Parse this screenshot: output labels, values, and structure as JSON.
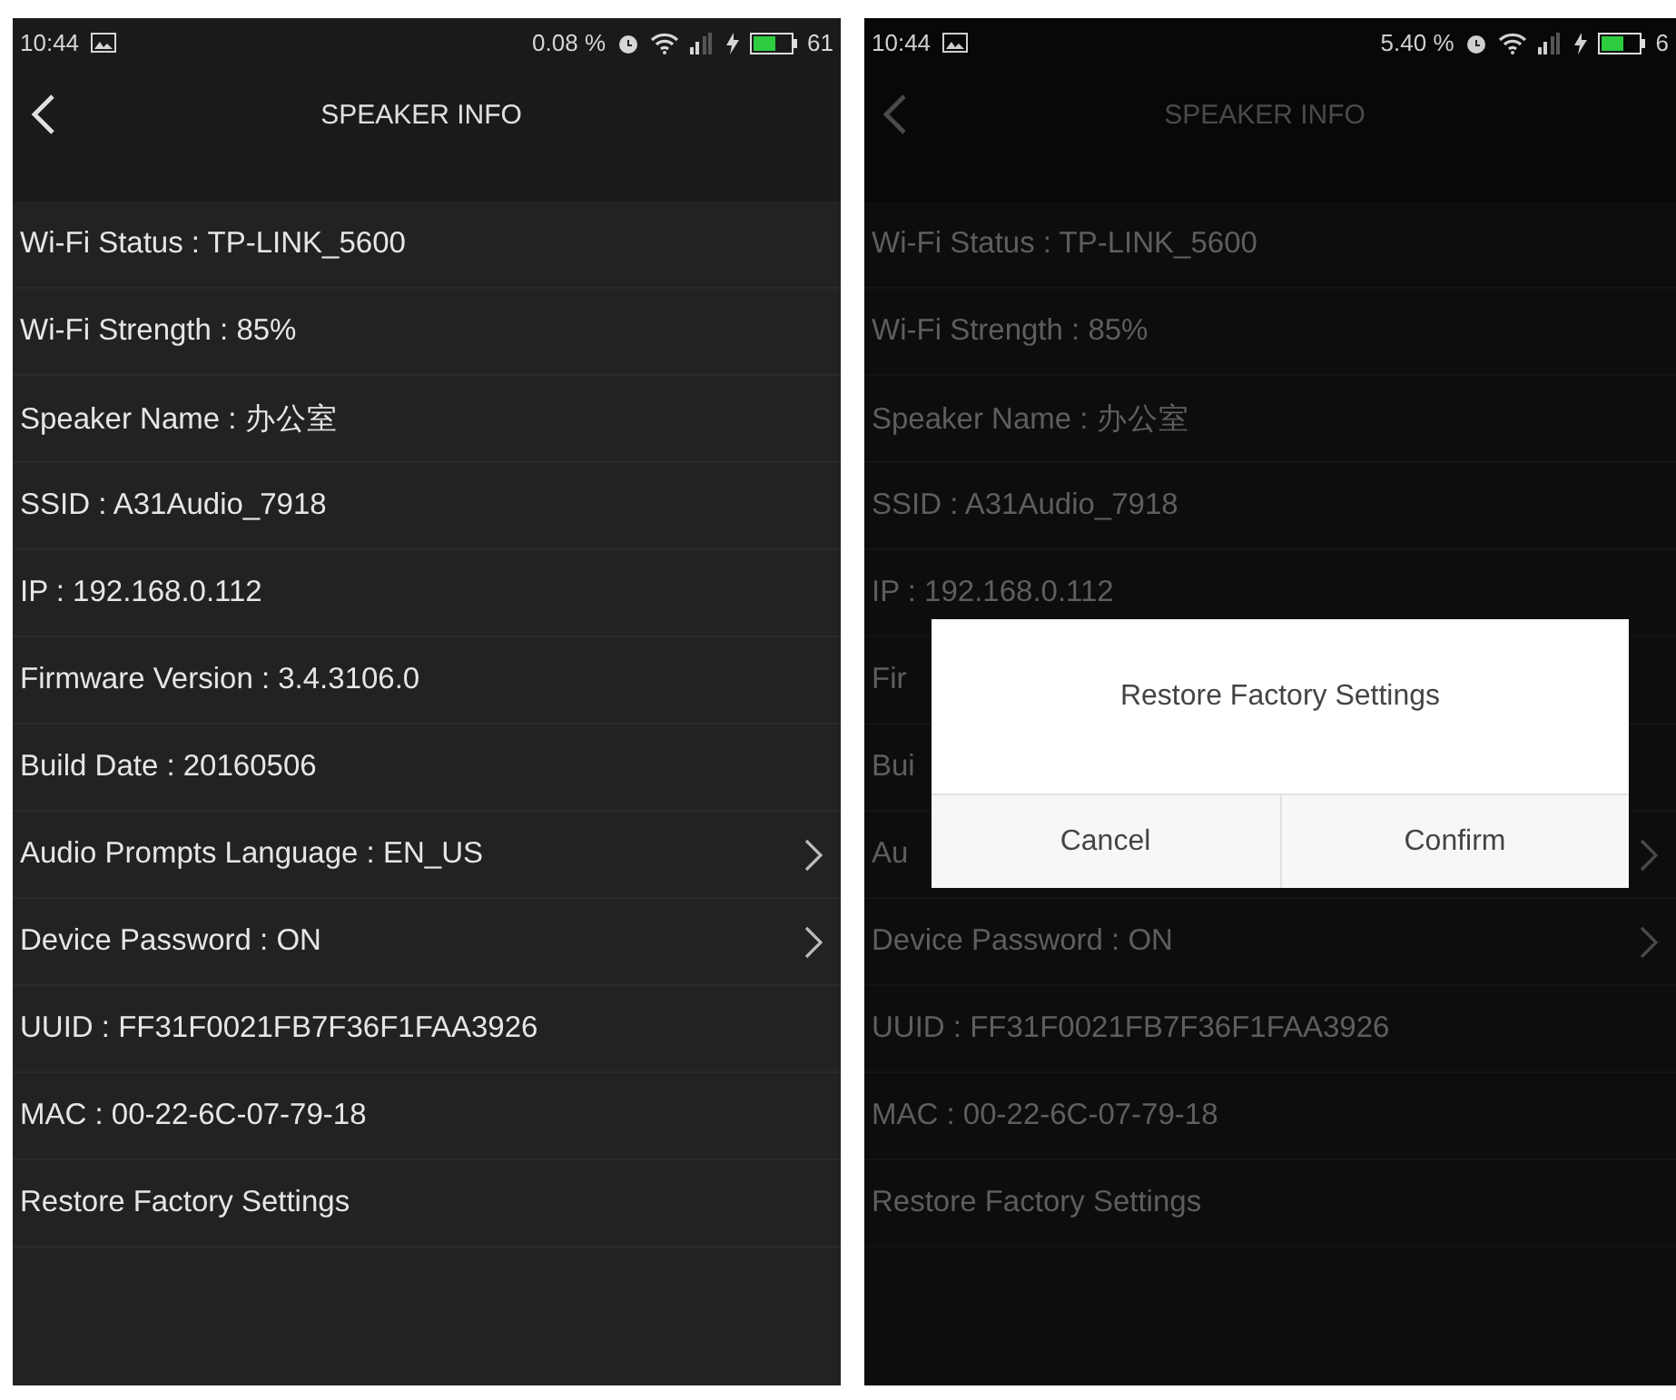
{
  "screens": [
    {
      "dimmed": false,
      "status_bar": {
        "time": "10:44",
        "data_rate": "0.08 %",
        "battery": "61"
      },
      "title": "SPEAKER INFO",
      "rows": [
        {
          "label": "Wi-Fi Status : TP-LINK_5600",
          "chevron": false
        },
        {
          "label": "Wi-Fi Strength : 85%",
          "chevron": false
        },
        {
          "label": "Speaker Name : 办公室",
          "chevron": false
        },
        {
          "label": "SSID : A31Audio_7918",
          "chevron": false
        },
        {
          "label": "IP : 192.168.0.112",
          "chevron": false
        },
        {
          "label": "Firmware Version : 3.4.3106.0",
          "chevron": false
        },
        {
          "label": "Build Date : 20160506",
          "chevron": false
        },
        {
          "label": "Audio Prompts Language : EN_US",
          "chevron": true
        },
        {
          "label": "Device Password : ON",
          "chevron": true
        },
        {
          "label": "UUID : FF31F0021FB7F36F1FAA3926",
          "chevron": false
        },
        {
          "label": "MAC : 00-22-6C-07-79-18",
          "chevron": false
        },
        {
          "label": "Restore Factory Settings",
          "chevron": false
        }
      ]
    },
    {
      "dimmed": true,
      "status_bar": {
        "time": "10:44",
        "data_rate": "5.40 %",
        "battery": "6"
      },
      "title": "SPEAKER INFO",
      "rows": [
        {
          "label": "Wi-Fi Status : TP-LINK_5600",
          "chevron": false
        },
        {
          "label": "Wi-Fi Strength : 85%",
          "chevron": false
        },
        {
          "label": "Speaker Name : 办公室",
          "chevron": false
        },
        {
          "label": "SSID : A31Audio_7918",
          "chevron": false
        },
        {
          "label": "IP : 192.168.0.112",
          "chevron": false
        },
        {
          "label": "Fir",
          "chevron": false
        },
        {
          "label": "Bui",
          "chevron": false
        },
        {
          "label": "Au",
          "chevron": true
        },
        {
          "label": "Device Password : ON",
          "chevron": true
        },
        {
          "label": "UUID : FF31F0021FB7F36F1FAA3926",
          "chevron": false
        },
        {
          "label": "MAC : 00-22-6C-07-79-18",
          "chevron": false
        },
        {
          "label": "Restore Factory Settings",
          "chevron": false
        }
      ],
      "dialog": {
        "title": "Restore Factory Settings",
        "buttons": [
          "Cancel",
          "Confirm"
        ]
      }
    }
  ]
}
